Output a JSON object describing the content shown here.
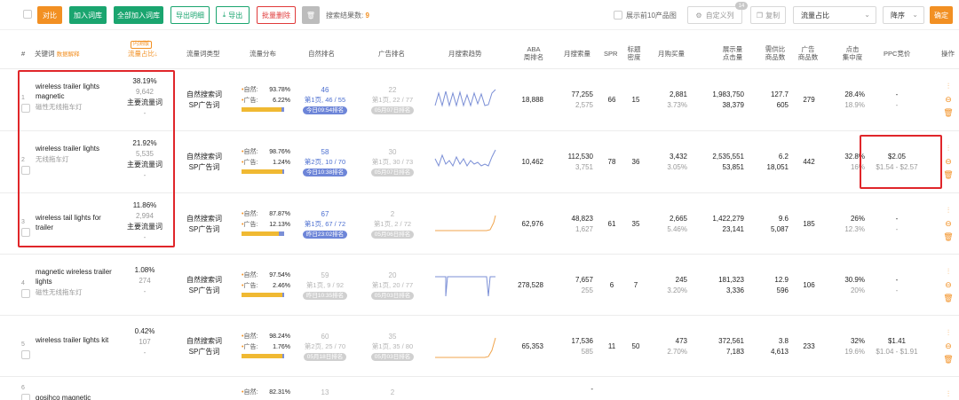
{
  "toolbar": {
    "compare": "对比",
    "add_lib": "加入词库",
    "add_all": "全部加入词库",
    "export_detail": "导出明细",
    "export": "导出",
    "batch_delete": "批量删除",
    "result_label": "搜索结果数:",
    "result_count": "9",
    "show_top10": "展示前10产品图",
    "custom_cols": "自定义列",
    "custom_badge": "14",
    "copy": "复制",
    "sort_field": "流量占比",
    "sort_order": "降序",
    "confirm": "确定"
  },
  "headers": {
    "idx": "#",
    "keyword": "关键词",
    "keyword_link": "数据解释",
    "new_badge": "内测版",
    "share": "流量占比",
    "type": "流量词类型",
    "flow": "流量分布",
    "natural_rank": "自然排名",
    "ad_rank": "广告排名",
    "trend": "月搜索趋势",
    "aba": [
      "ABA",
      "周排名"
    ],
    "monthly": "月搜索量",
    "spr": "SPR",
    "title_density": [
      "标题",
      "密度"
    ],
    "monthly_buy": "月购买量",
    "impressions": [
      "展示量",
      "点击量"
    ],
    "supply_ratio": [
      "需供比",
      "商品数"
    ],
    "ad_products": [
      "广告",
      "商品数"
    ],
    "click_concentration": [
      "点击",
      "集中度"
    ],
    "ppc": "PPC竞价",
    "ops": "操作"
  },
  "rows": [
    {
      "idx": "1",
      "keyword": "wireless trailer lights magnetic",
      "keyword_cn": "磁性无线拖车灯",
      "share_pct": "38.19%",
      "share_vol": "9,642",
      "share_type": "主要流量词",
      "share_dash": "-",
      "type1": "自然搜索词",
      "type2": "SP广告词",
      "flow_nat": "93.78%",
      "flow_ad": "6.22%",
      "flow_ad_frac": 0.0622,
      "nat_rank": "46",
      "nat_page": "第1页, 46 / 55",
      "nat_tag": "今日09:54排名",
      "ad_rank": "22",
      "ad_page": "第1页, 22 / 77",
      "ad_tag": "05月07日排名",
      "aba": "18,888",
      "monthly": "77,255",
      "monthly_sub": "2,575",
      "spr": "66",
      "density": "15",
      "buy": "2,881",
      "buy_sub": "3.73%",
      "imp": "1,983,750",
      "clicks": "38,379",
      "ratio": "127.7",
      "products": "605",
      "ad_products": "279",
      "conc": "28.4%",
      "conc_sub": "18.9%",
      "ppc": "-",
      "ppc_sub": "-"
    },
    {
      "idx": "2",
      "keyword": "wireless trailer lights",
      "keyword_cn": "无线拖车灯",
      "share_pct": "21.92%",
      "share_vol": "5,535",
      "share_type": "主要流量词",
      "share_dash": "-",
      "type1": "自然搜索词",
      "type2": "SP广告词",
      "flow_nat": "98.76%",
      "flow_ad": "1.24%",
      "flow_ad_frac": 0.0124,
      "nat_rank": "58",
      "nat_page": "第2页, 10 / 70",
      "nat_tag": "今日10:38排名",
      "ad_rank": "30",
      "ad_page": "第1页, 30 / 73",
      "ad_tag": "05月07日排名",
      "aba": "10,462",
      "monthly": "112,530",
      "monthly_sub": "3,751",
      "spr": "78",
      "density": "36",
      "buy": "3,432",
      "buy_sub": "3.05%",
      "imp": "2,535,551",
      "clicks": "53,851",
      "ratio": "6.2",
      "products": "18,051",
      "ad_products": "442",
      "conc": "32.8%",
      "conc_sub": "16%",
      "ppc": "$2.05",
      "ppc_sub": "$1.54 - $2.57"
    },
    {
      "idx": "3",
      "keyword": "wireless tail lights for trailer",
      "keyword_cn": "",
      "share_pct": "11.86%",
      "share_vol": "2,994",
      "share_type": "主要流量词",
      "share_dash": "-",
      "type1": "自然搜索词",
      "type2": "SP广告词",
      "flow_nat": "87.87%",
      "flow_ad": "12.13%",
      "flow_ad_frac": 0.1213,
      "nat_rank": "67",
      "nat_page": "第1页, 67 / 72",
      "nat_tag": "昨日23:02排名",
      "ad_rank": "2",
      "ad_page": "第1页, 2 / 72",
      "ad_tag": "05月06日排名",
      "aba": "62,976",
      "monthly": "48,823",
      "monthly_sub": "1,627",
      "spr": "61",
      "density": "35",
      "buy": "2,665",
      "buy_sub": "5.46%",
      "imp": "1,422,279",
      "clicks": "23,141",
      "ratio": "9.6",
      "products": "5,087",
      "ad_products": "185",
      "conc": "26%",
      "conc_sub": "12.3%",
      "ppc": "-",
      "ppc_sub": "-"
    },
    {
      "idx": "4",
      "keyword": "magnetic wireless trailer lights",
      "keyword_cn": "磁性无线拖车灯",
      "share_pct": "1.08%",
      "share_vol": "274",
      "share_type": "",
      "share_dash": "-",
      "type1": "自然搜索词",
      "type2": "SP广告词",
      "flow_nat": "97.54%",
      "flow_ad": "2.46%",
      "flow_ad_frac": 0.0246,
      "nat_rank": "59",
      "nat_page": "第1页, 9 / 92",
      "nat_tag": "昨日10:35排名",
      "ad_rank": "20",
      "ad_page": "第1页, 20 / 77",
      "ad_tag": "05月03日排名",
      "aba": "278,528",
      "monthly": "7,657",
      "monthly_sub": "255",
      "spr": "6",
      "density": "7",
      "buy": "245",
      "buy_sub": "3.20%",
      "imp": "181,323",
      "clicks": "3,336",
      "ratio": "12.9",
      "products": "596",
      "ad_products": "106",
      "conc": "30.9%",
      "conc_sub": "20%",
      "ppc": "-",
      "ppc_sub": "-"
    },
    {
      "idx": "5",
      "keyword": "wireless trailer lights kit",
      "keyword_cn": "",
      "share_pct": "0.42%",
      "share_vol": "107",
      "share_type": "",
      "share_dash": "-",
      "type1": "自然搜索词",
      "type2": "SP广告词",
      "flow_nat": "98.24%",
      "flow_ad": "1.76%",
      "flow_ad_frac": 0.0176,
      "nat_rank": "60",
      "nat_page": "第2页, 25 / 70",
      "nat_tag": "05月18日排名",
      "ad_rank": "35",
      "ad_page": "第1页, 35 / 80",
      "ad_tag": "05月03日排名",
      "aba": "65,353",
      "monthly": "17,536",
      "monthly_sub": "585",
      "spr": "11",
      "density": "50",
      "buy": "473",
      "buy_sub": "2.70%",
      "imp": "372,561",
      "clicks": "7,183",
      "ratio": "3.8",
      "products": "4,613",
      "ad_products": "233",
      "conc": "32%",
      "conc_sub": "19.6%",
      "ppc": "$1.41",
      "ppc_sub": "$1.04 - $1.91"
    },
    {
      "idx": "6",
      "keyword": "gosihco magnetic",
      "flow_nat": "82.31%",
      "nat_rank": "13",
      "ad_rank": "2",
      "monthly": "-"
    }
  ],
  "colors": {
    "accent": "#f29023",
    "green": "#1aa56f",
    "red": "#e03a3a",
    "link": "#4c6fd0",
    "highlight": "#e0262a"
  }
}
